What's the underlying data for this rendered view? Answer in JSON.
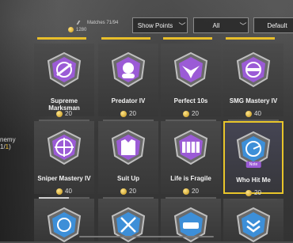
{
  "header": {
    "matches": "Matches 71/94",
    "coins": "1280"
  },
  "left_edge": {
    "line1": "nemy",
    "line2a": "1/",
    "line2b": "1",
    "line2c": ")"
  },
  "filters": {
    "sort": {
      "label": "Show Points"
    },
    "category": {
      "label": "All"
    },
    "order": {
      "label": "Default"
    }
  },
  "achievements": [
    {
      "name": "Supreme Marksman",
      "reward": "20",
      "progress": 0.0,
      "icon": "target-pistol"
    },
    {
      "name": "Predator IV",
      "reward": "20",
      "progress": 0.0,
      "icon": "soldier-head"
    },
    {
      "name": "Perfect 10s",
      "reward": "20",
      "progress": 0.0,
      "icon": "flying-bird"
    },
    {
      "name": "SMG Mastery IV",
      "reward": "40",
      "progress": 0.0,
      "icon": "crosshair-smg"
    },
    {
      "name": "Sniper Mastery IV",
      "reward": "40",
      "progress": 0.6,
      "icon": "scope"
    },
    {
      "name": "Suit Up",
      "reward": "20",
      "progress": 0.0,
      "icon": "vest"
    },
    {
      "name": "Life is Fragile",
      "reward": "20",
      "progress": 0.0,
      "icon": "crate"
    },
    {
      "name": "Who Hit Me",
      "reward": "20",
      "progress": 0.0,
      "icon": "radar",
      "tag": "Note",
      "selected": true
    }
  ],
  "colors": {
    "accent": "#e8be2a",
    "emblem_purple": "#9b5bd6",
    "emblem_blue": "#3d8fd8"
  }
}
